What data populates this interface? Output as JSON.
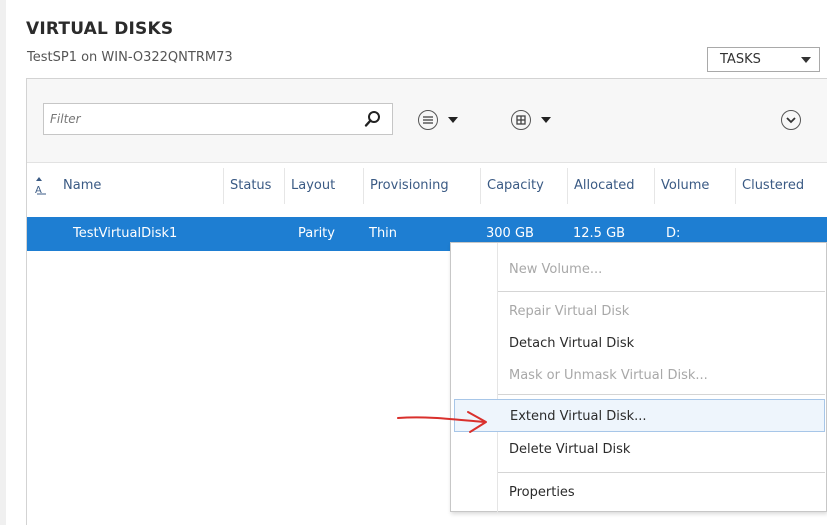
{
  "section": {
    "title": "VIRTUAL DISKS",
    "subtitle": "TestSP1 on WIN-O322QNTRM73",
    "tasks_label": "TASKS"
  },
  "toolbar": {
    "filter_placeholder": "Filter",
    "icons": [
      "search-icon",
      "list-view-icon",
      "group-icon",
      "expand-icon"
    ]
  },
  "table": {
    "columns": [
      "Name",
      "Status",
      "Layout",
      "Provisioning",
      "Capacity",
      "Allocated",
      "Volume",
      "Clustered"
    ],
    "rows": [
      {
        "name": "TestVirtualDisk1",
        "status": "",
        "layout": "Parity",
        "provisioning": "Thin",
        "capacity": "300 GB",
        "allocated": "12.5 GB",
        "volume": "D:",
        "clustered": ""
      }
    ],
    "selected_row_color": "#1e7ed2"
  },
  "context_menu": {
    "items": [
      {
        "label": "New Volume...",
        "enabled": false
      },
      {
        "label": "Repair Virtual Disk",
        "enabled": false
      },
      {
        "label": "Detach Virtual Disk",
        "enabled": true
      },
      {
        "label": "Mask or Unmask Virtual Disk...",
        "enabled": false
      },
      {
        "label": "Extend Virtual Disk...",
        "enabled": true,
        "highlighted": true
      },
      {
        "label": "Delete Virtual Disk",
        "enabled": true
      },
      {
        "label": "Properties",
        "enabled": true
      }
    ]
  },
  "annotation": {
    "arrow_color": "#d9302c"
  }
}
